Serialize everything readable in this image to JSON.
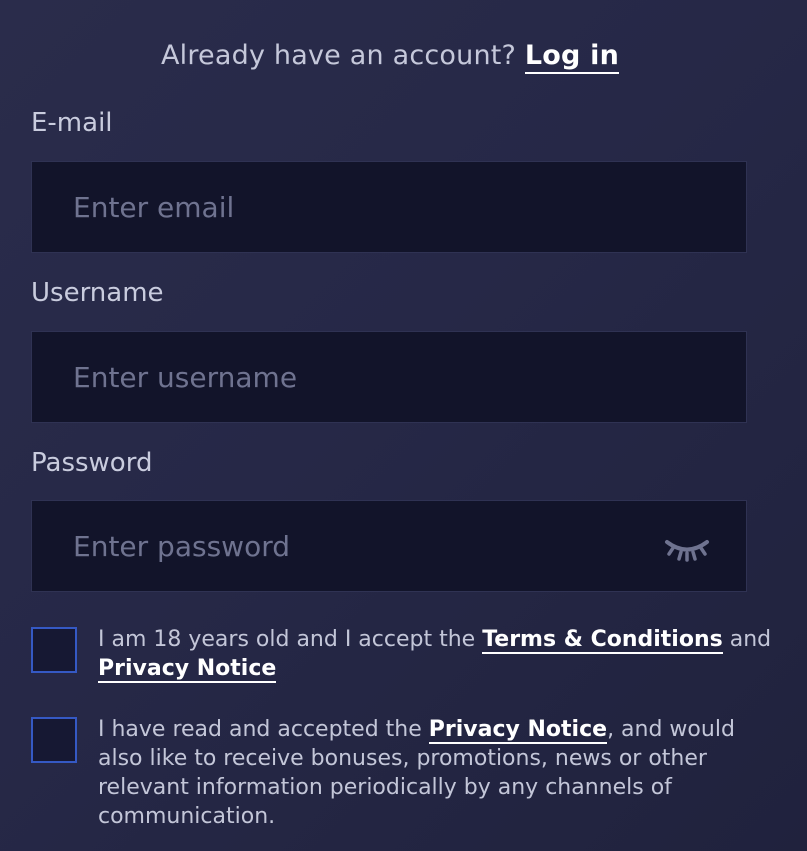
{
  "login_prompt": {
    "text": "Already have an account? ",
    "link": "Log in"
  },
  "email": {
    "label": "E-mail",
    "placeholder": "Enter email",
    "value": ""
  },
  "username": {
    "label": "Username",
    "placeholder": "Enter username",
    "value": ""
  },
  "password": {
    "label": "Password",
    "placeholder": "Enter password",
    "value": "",
    "toggle_icon": "eye-closed-icon"
  },
  "consent_age": {
    "checked": false,
    "text_before": "I am 18 years old and I accept the ",
    "terms_link": "Terms & Conditions",
    "text_middle": " and ",
    "privacy_link": "Privacy Notice"
  },
  "consent_marketing": {
    "checked": false,
    "text_before": "I have read and accepted the ",
    "privacy_link": "Privacy Notice",
    "text_after": ", and would also like to receive bonuses, promotions, news or other relevant information periodically by any channels of communication."
  },
  "colors": {
    "background": "#262847",
    "input_background": "#12142a",
    "checkbox_border": "#3559c4",
    "link": "#ffffff",
    "placeholder": "#6f7390"
  }
}
